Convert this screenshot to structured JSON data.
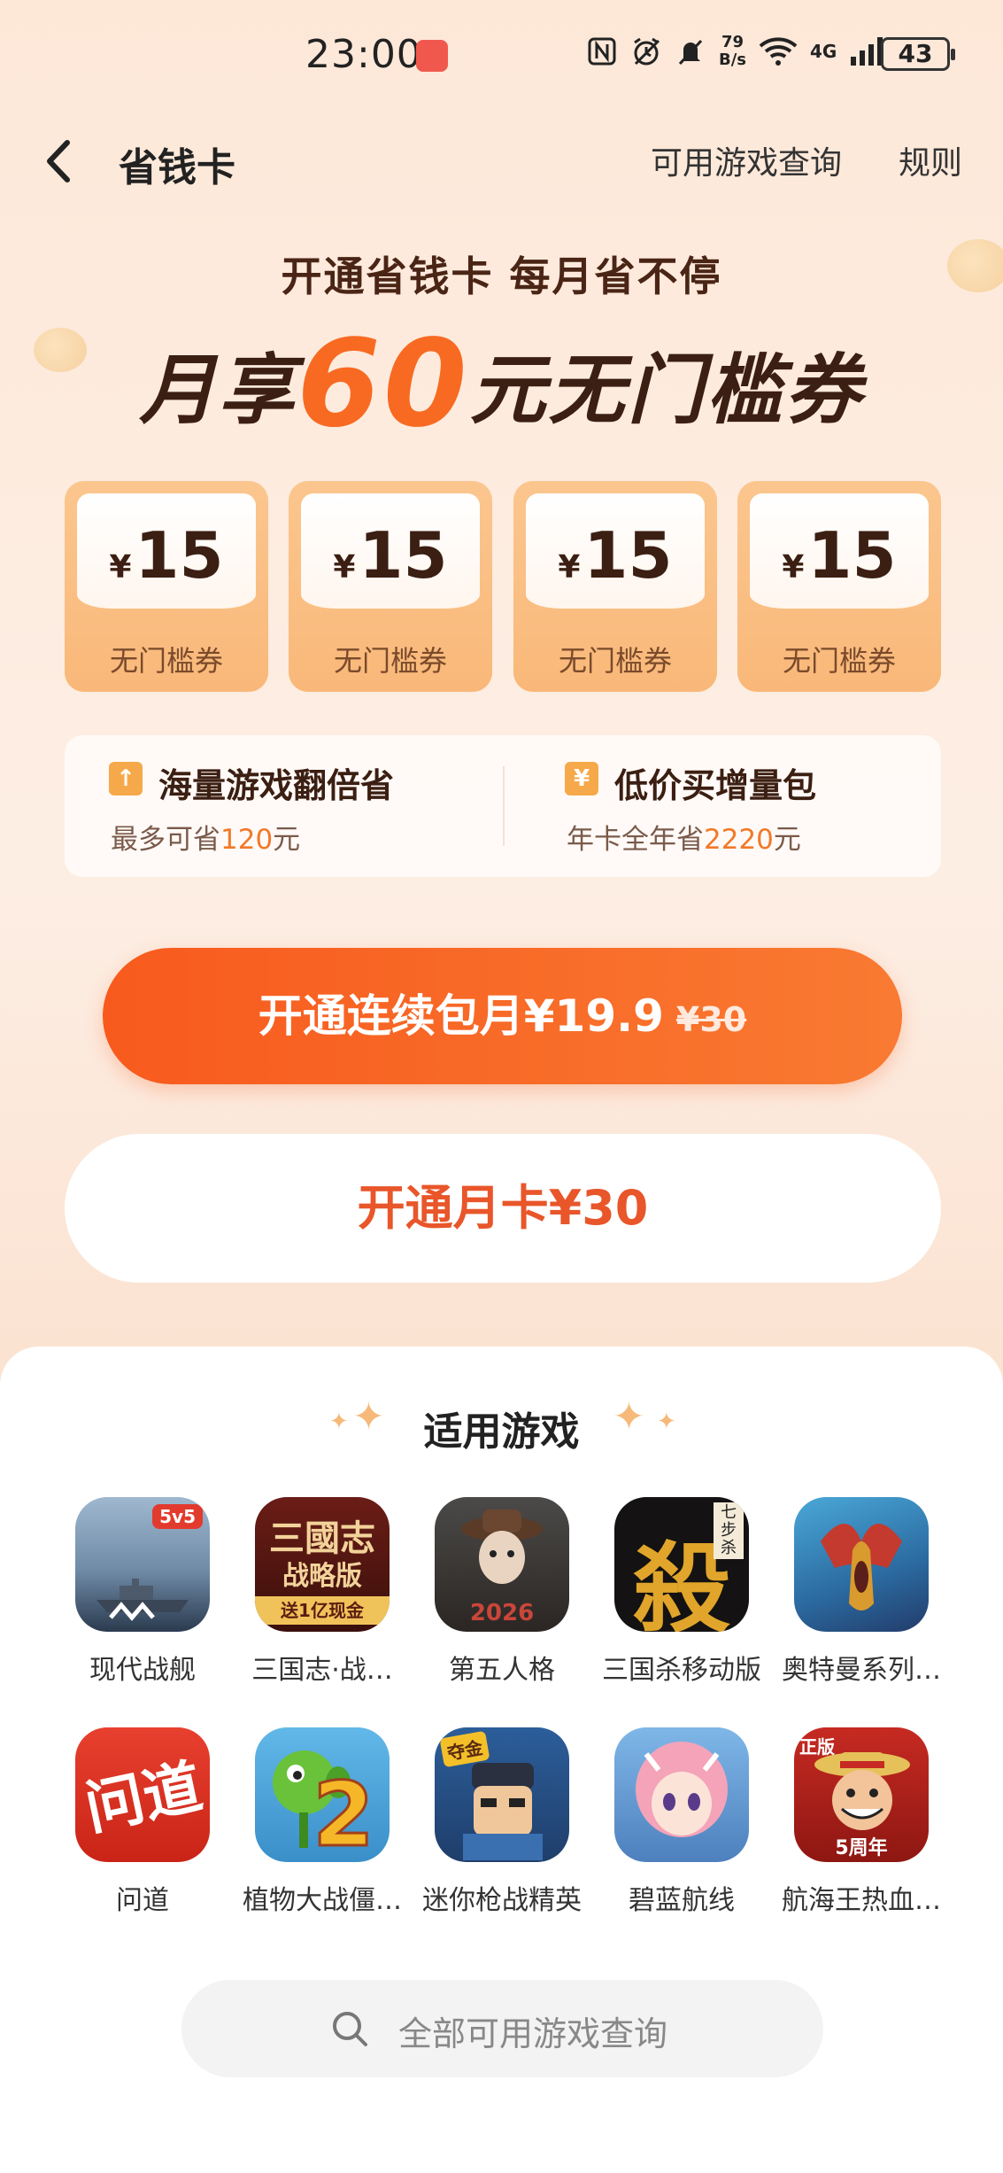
{
  "status_bar": {
    "time": "23:00",
    "net_speed_value": "79",
    "net_speed_unit": "B/s",
    "network": "4G",
    "battery": "43",
    "icons": [
      "nfc-icon",
      "alarm-icon",
      "mute-icon",
      "wifi-icon",
      "signal-icon"
    ]
  },
  "header": {
    "back_icon": "chevron-left-icon",
    "title": "省钱卡",
    "query_link": "可用游戏查询",
    "rules_link": "规则"
  },
  "hero": {
    "subtitle": "开通省钱卡 每月省不停",
    "main_prefix": "月享",
    "main_number": "60",
    "main_suffix": "元无门槛券"
  },
  "coupons": [
    {
      "currency": "¥",
      "amount": "15",
      "label": "无门槛券"
    },
    {
      "currency": "¥",
      "amount": "15",
      "label": "无门槛券"
    },
    {
      "currency": "¥",
      "amount": "15",
      "label": "无门槛券"
    },
    {
      "currency": "¥",
      "amount": "15",
      "label": "无门槛券"
    }
  ],
  "benefits": [
    {
      "icon": "arrow-up-icon",
      "title": "海量游戏翻倍省",
      "desc_prefix": "最多可省",
      "desc_highlight": "120",
      "desc_suffix": "元"
    },
    {
      "icon": "yuan-down-icon",
      "title": "低价买增量包",
      "desc_prefix": "年卡全年省",
      "desc_highlight": "2220",
      "desc_suffix": "元"
    }
  ],
  "buttons": {
    "primary_label": "开通连续包月¥19.9",
    "primary_original": "¥30",
    "secondary_label": "开通月卡¥30"
  },
  "games_section": {
    "title": "适用游戏",
    "games": [
      {
        "name": "现代战舰",
        "badge": "5v5"
      },
      {
        "name": "三国志·战…",
        "art_text": "三國志",
        "art_sub": "战略版",
        "art_banner": "送1亿现金"
      },
      {
        "name": "第五人格",
        "art_text": "2026"
      },
      {
        "name": "三国杀移动版",
        "art_text": "殺",
        "art_sub": "七步杀"
      },
      {
        "name": "奥特曼系列…"
      },
      {
        "name": "问道",
        "art_text": "问道"
      },
      {
        "name": "植物大战僵…",
        "art_text": "2"
      },
      {
        "name": "迷你枪战精英",
        "art_text": "夺金"
      },
      {
        "name": "碧蓝航线"
      },
      {
        "name": "航海王热血…",
        "art_text": "正版",
        "art_sub": "5周年"
      }
    ],
    "search_placeholder": "全部可用游戏查询"
  },
  "colors": {
    "accent_orange": "#f86a22",
    "primary_button": "#f85a1d",
    "secondary_text": "#e8562a",
    "coupon_frame": "#f9b879"
  }
}
